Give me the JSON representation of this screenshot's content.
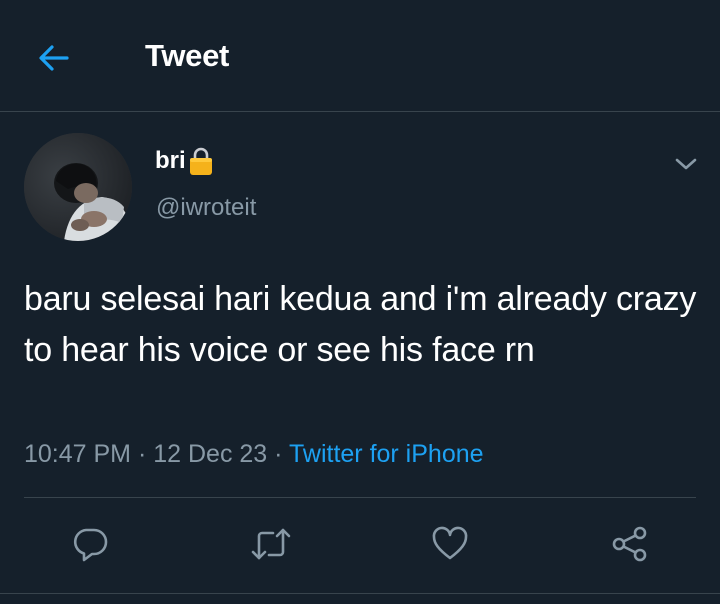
{
  "header": {
    "title": "Tweet",
    "back_icon": "arrow-left-icon",
    "accent_color": "#1da1f2"
  },
  "tweet": {
    "author": {
      "display_name": "bri",
      "badge_icon": "lock-icon",
      "handle": "@iwroteit"
    },
    "text": "baru selesai hari kedua and i'm already crazy to hear his voice or see his face rn",
    "time": "10:47 PM",
    "separator": "·",
    "date": "12 Dec 23",
    "source": "Twitter for iPhone",
    "menu_icon": "chevron-down-icon"
  },
  "actions": [
    {
      "name": "reply",
      "icon": "reply-icon"
    },
    {
      "name": "retweet",
      "icon": "retweet-icon"
    },
    {
      "name": "like",
      "icon": "heart-icon"
    },
    {
      "name": "share",
      "icon": "share-icon"
    }
  ],
  "colors": {
    "background": "#15202b",
    "text": "#ffffff",
    "secondary": "#8899a6",
    "divider": "#38444d",
    "link": "#1da1f2"
  }
}
